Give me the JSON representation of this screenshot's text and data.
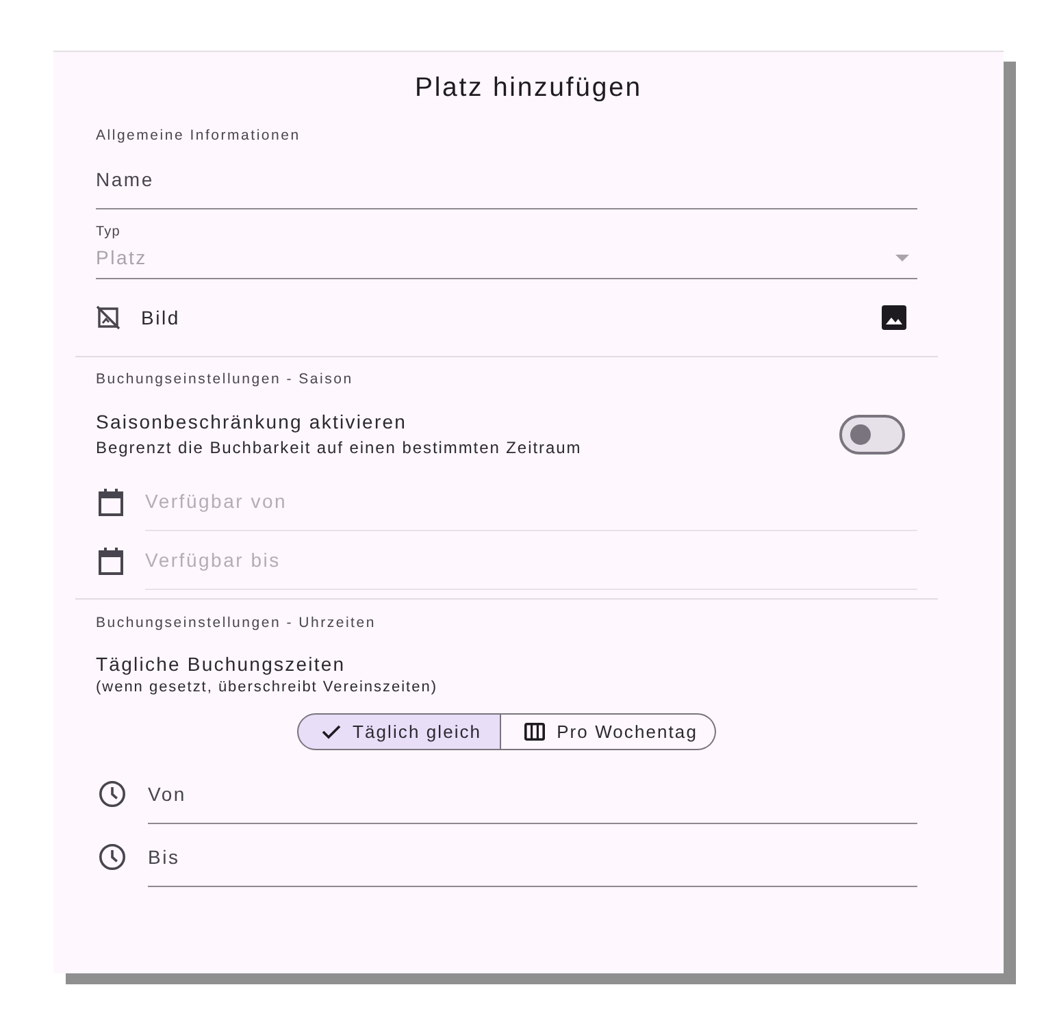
{
  "dialog": {
    "title": "Platz hinzufügen"
  },
  "sections": [
    {
      "heading": "Allgemeine Informationen",
      "items": [
        {
          "kind": "text_field",
          "label": "Name"
        },
        {
          "kind": "select",
          "label": "Typ",
          "placeholder": "Platz"
        },
        {
          "kind": "image_picker",
          "label": "Bild"
        }
      ]
    },
    {
      "heading": "Buchungseinstellungen - Saison",
      "items": [
        {
          "kind": "switch",
          "title": "Saisonbeschränkung aktivieren",
          "subtitle": "Begrenzt die Buchbarkeit auf einen bestimmten Zeitraum",
          "on": false
        },
        {
          "kind": "date_field",
          "label": "Verfügbar von",
          "disabled": true
        },
        {
          "kind": "date_field",
          "label": "Verfügbar bis",
          "disabled": true
        }
      ]
    },
    {
      "heading": "Buchungseinstellungen - Uhrzeiten",
      "items": [
        {
          "kind": "info",
          "title": "Tägliche Buchungszeiten",
          "subtitle": "(wenn gesetzt, überschreibt Vereinszeiten)"
        },
        {
          "kind": "segmented",
          "options": [
            {
              "label": "Täglich gleich",
              "selected": true
            },
            {
              "label": "Pro Wochentag",
              "selected": false
            }
          ]
        },
        {
          "kind": "time_field",
          "label": "Von"
        },
        {
          "kind": "time_field",
          "label": "Bis"
        }
      ]
    }
  ]
}
